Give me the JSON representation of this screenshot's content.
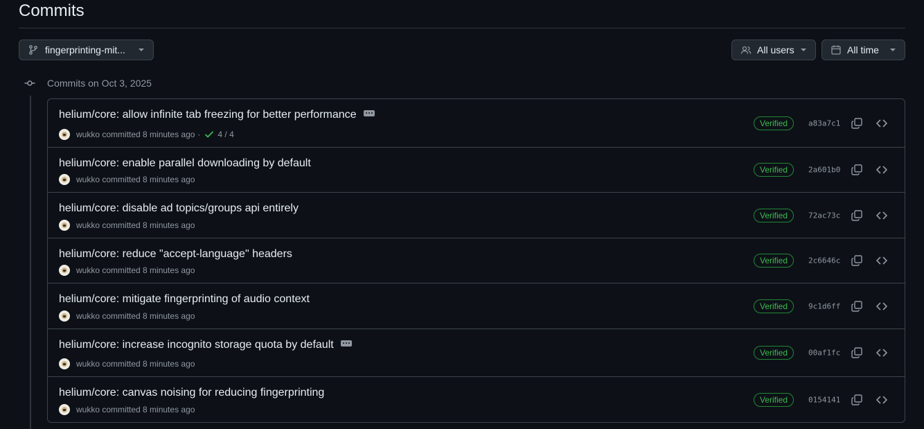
{
  "page": {
    "title": "Commits"
  },
  "filters": {
    "branch_label": "fingerprinting-mit...",
    "users_label": "All users",
    "time_label": "All time"
  },
  "day_group": {
    "label": "Commits on Oct 3, 2025"
  },
  "colors": {
    "verified": "#3fb950",
    "border": "#3d444d",
    "bg": "#0d1117"
  },
  "commits": [
    {
      "message": "helium/core: allow infinite tab freezing for better performance",
      "author": "wukko",
      "time": "committed 8 minutes ago",
      "checks": "4 / 4",
      "badge": "Verified",
      "sha": "a83a7c1",
      "has_ellipsis": true
    },
    {
      "message": "helium/core: enable parallel downloading by default",
      "author": "wukko",
      "time": "committed 8 minutes ago",
      "badge": "Verified",
      "sha": "2a601b0",
      "has_ellipsis": false
    },
    {
      "message": "helium/core: disable ad topics/groups api entirely",
      "author": "wukko",
      "time": "committed 8 minutes ago",
      "badge": "Verified",
      "sha": "72ac73c",
      "has_ellipsis": false
    },
    {
      "message": "helium/core: reduce \"accept-language\" headers",
      "author": "wukko",
      "time": "committed 8 minutes ago",
      "badge": "Verified",
      "sha": "2c6646c",
      "has_ellipsis": false
    },
    {
      "message": "helium/core: mitigate fingerprinting of audio context",
      "author": "wukko",
      "time": "committed 8 minutes ago",
      "badge": "Verified",
      "sha": "9c1d6ff",
      "has_ellipsis": false
    },
    {
      "message": "helium/core: increase incognito storage quota by default",
      "author": "wukko",
      "time": "committed 8 minutes ago",
      "badge": "Verified",
      "sha": "00af1fc",
      "has_ellipsis": true
    },
    {
      "message": "helium/core: canvas noising for reducing fingerprinting",
      "author": "wukko",
      "time": "committed 8 minutes ago",
      "badge": "Verified",
      "sha": "0154141",
      "has_ellipsis": false
    }
  ]
}
